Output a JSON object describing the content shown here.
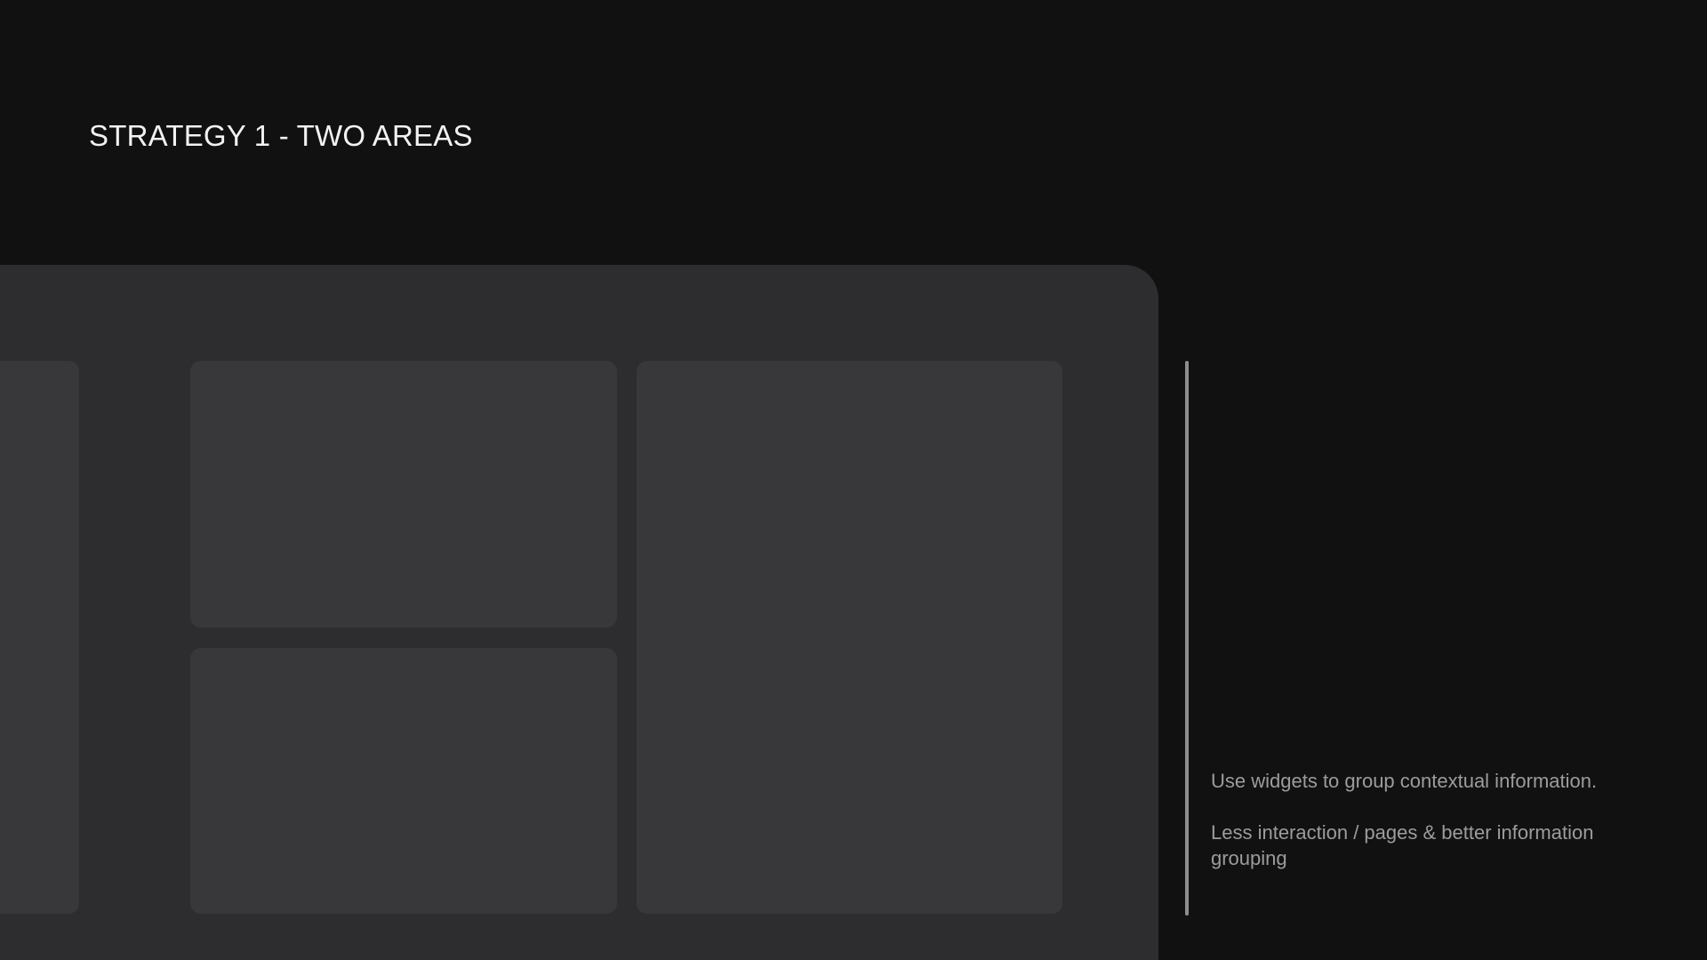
{
  "slide": {
    "title": "STRATEGY 1 - TWO AREAS"
  },
  "mockup": {
    "frame_color": "#2d2d2f",
    "widget_color": "#38383a",
    "widgets": [
      "left-panel",
      "top-middle",
      "bottom-middle",
      "right-tall"
    ]
  },
  "notes": {
    "divider_color": "#8e8e90",
    "text_color": "#9c9c9e",
    "items": [
      "Use widgets to group contextual information.",
      "Less interaction / pages & better information grouping"
    ]
  },
  "theme": {
    "background": "#111111",
    "title_color": "#f2f2f2"
  }
}
